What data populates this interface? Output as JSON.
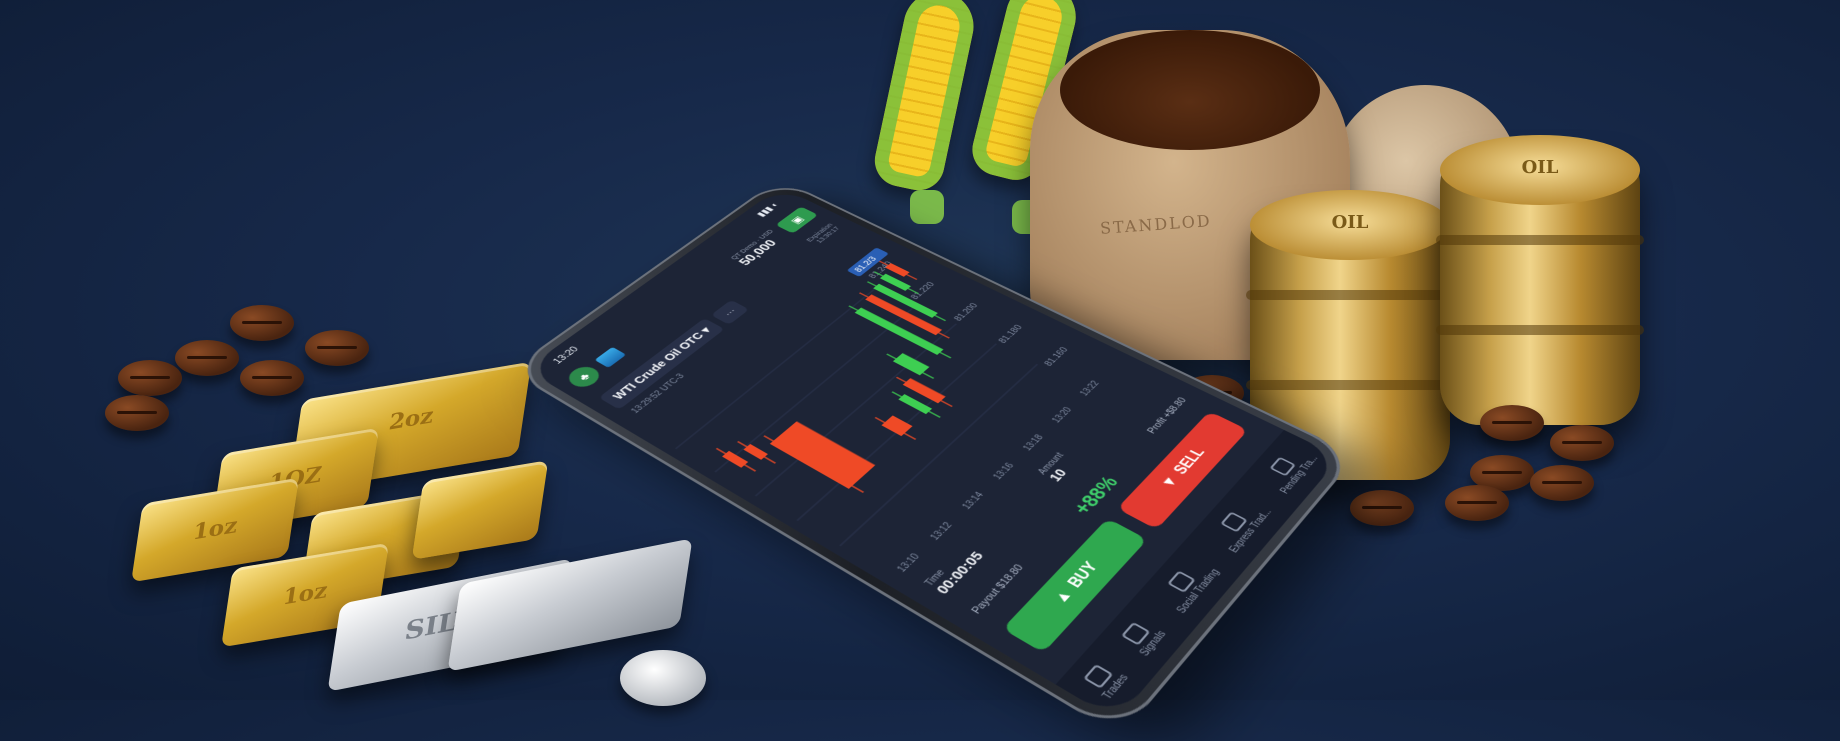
{
  "app": {
    "status_time": "13:20",
    "account_label": "QT Demo · USD",
    "balance": "50,000",
    "asset": "WTI Crude Oil OTC",
    "more": "···",
    "server_time": "13:29:52 UTC-3",
    "expiration_label": "Expiration",
    "expiration_value": "13:30:17",
    "price_badge": "81.2/3",
    "price_levels": [
      "81.240",
      "81.220",
      "81.200",
      "81.180",
      "81.160"
    ],
    "colors": {
      "up": "#3ecf52",
      "down": "#ef4a26",
      "buy": "#2fa84f",
      "sell": "#e23a31"
    }
  },
  "chart_data": {
    "type": "candlestick",
    "candles": [
      {
        "dir": "down"
      },
      {
        "dir": "down"
      },
      {
        "dir": "down"
      },
      {
        "dir": "down"
      },
      {
        "dir": "up"
      },
      {
        "dir": "down"
      },
      {
        "dir": "up"
      },
      {
        "dir": "up"
      },
      {
        "dir": "down"
      },
      {
        "dir": "up"
      },
      {
        "dir": "up"
      },
      {
        "dir": "down"
      }
    ]
  },
  "controls": {
    "time_label": "Time",
    "time_value": "00:00:05",
    "amount_label": "Amount",
    "amount_value": "10",
    "payout_label": "Payout $18.80",
    "profit_label": "Profit +$8.80",
    "profit_pct": "+88%",
    "buy_label": "BUY",
    "sell_label": "SELL"
  },
  "x_ticks": [
    "13:10",
    "13:12",
    "13:14",
    "13:16",
    "13:18",
    "13:20",
    "13:22"
  ],
  "nav": [
    {
      "label": "Trades",
      "icon": "history-icon"
    },
    {
      "label": "Signals",
      "icon": "signal-icon"
    },
    {
      "label": "Social Trading",
      "icon": "people-icon"
    },
    {
      "label": "Express Trad...",
      "icon": "express-icon"
    },
    {
      "label": "Pending Tra...",
      "icon": "clock-icon"
    }
  ],
  "props": {
    "gold_bar_labels": [
      "2oz",
      "1OZ",
      "1oz",
      "1oz"
    ],
    "silver_bar_label": "SILVE",
    "sack_label": "STANDLOD",
    "barrel_labels": [
      "OIL",
      "OIL"
    ]
  }
}
